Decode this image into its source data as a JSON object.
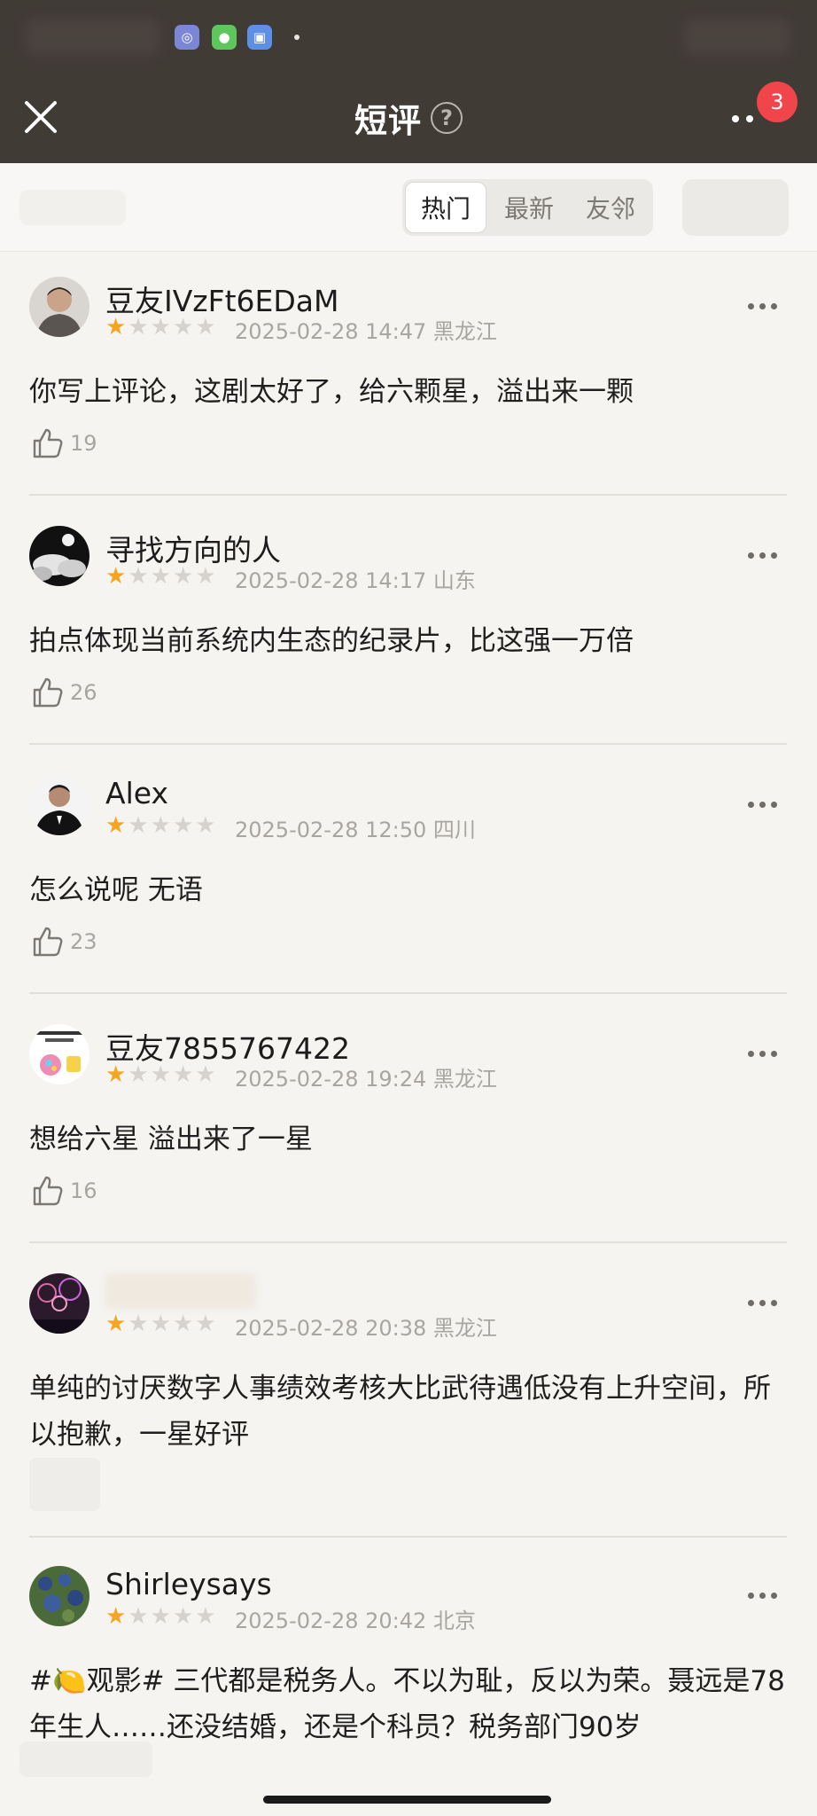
{
  "header": {
    "title": "短评",
    "help": "?",
    "badge_count": "3"
  },
  "tabs": [
    {
      "label": "热门",
      "active": true
    },
    {
      "label": "最新",
      "active": false
    },
    {
      "label": "友邻",
      "active": false
    }
  ],
  "rating_scale": 5,
  "comments": [
    {
      "user": "豆友IVzFt6EDaM",
      "stars": 1,
      "meta": "2025-02-28 14:47 黑龙江",
      "text": "你写上评论，这剧太好了，给六颗星，溢出来一颗",
      "likes": "19",
      "avatar": "man-portrait"
    },
    {
      "user": "寻找方向的人",
      "stars": 1,
      "meta": "2025-02-28 14:17 山东",
      "text": "拍点体现当前系统内生态的纪录片，比这强一万倍",
      "likes": "26",
      "avatar": "moon-clouds"
    },
    {
      "user": "Alex",
      "stars": 1,
      "meta": "2025-02-28 12:50 四川",
      "text": "怎么说呢 无语",
      "likes": "23",
      "avatar": "man-in-tuxedo"
    },
    {
      "user": "豆友7855767422",
      "stars": 1,
      "meta": "2025-02-28 19:24 黑龙江",
      "text": "想给六星 溢出来了一星",
      "likes": "16",
      "avatar": "candy-illustration"
    },
    {
      "user": "",
      "stars": 1,
      "meta": "2025-02-28 20:38 黑龙江",
      "text": "单纯的讨厌数字人事绩效考核大比武待遇低没有上升空间，所以抱歉，一星好评",
      "likes": "",
      "avatar": "fireworks"
    },
    {
      "user": "Shirleysays",
      "stars": 1,
      "meta": "2025-02-28 20:42 北京",
      "text": "#🍋观影# 三代都是税务人。不以为耻，反以为荣。聂远是78年生人……还没结婚，还是个科员？税务部门90岁",
      "likes": "",
      "avatar": "flowers"
    }
  ],
  "colors": {
    "header_bg": "#413b36",
    "page_bg": "#f5f4f1",
    "star_on": "#f4a623",
    "star_off": "#d6d3cf",
    "badge": "#f0454a"
  }
}
